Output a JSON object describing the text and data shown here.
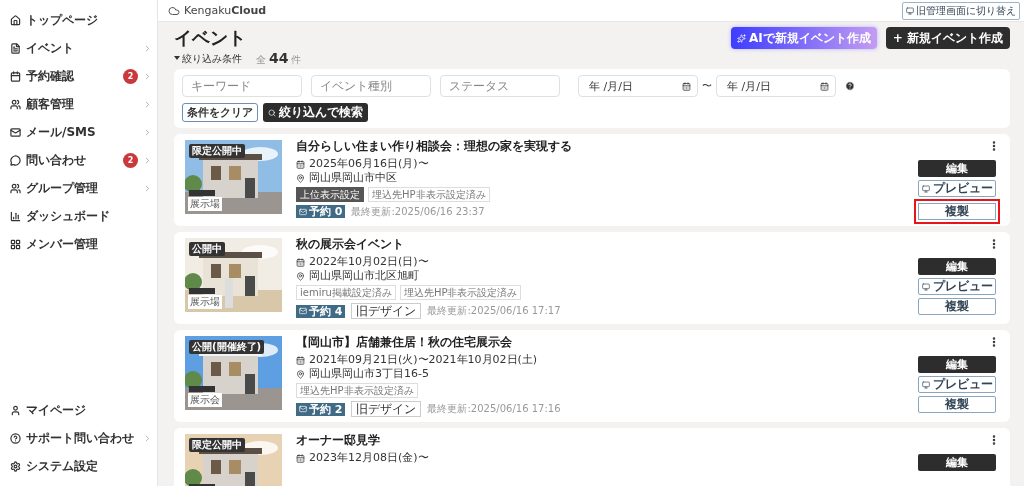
{
  "sidebar": {
    "items": [
      {
        "label": "トップページ",
        "chevron": false
      },
      {
        "label": "イベント",
        "chevron": true
      },
      {
        "label": "予約確認",
        "badge": "2",
        "chevron": true
      },
      {
        "label": "顧客管理",
        "chevron": true
      },
      {
        "label": "メール/SMS",
        "chevron": true
      },
      {
        "label": "問い合わせ",
        "badge": "2",
        "chevron": true
      },
      {
        "label": "グループ管理",
        "chevron": true
      },
      {
        "label": "ダッシュボード",
        "chevron": false
      },
      {
        "label": "メンバー管理",
        "chevron": false
      }
    ],
    "bottom_items": [
      {
        "label": "マイページ",
        "chevron": false
      },
      {
        "label": "サポート問い合わせ",
        "chevron": true
      },
      {
        "label": "システム設定",
        "chevron": false
      }
    ]
  },
  "header": {
    "logo_light": "Kengaku",
    "logo_bold": "Cloud",
    "switch_button": "旧管理画面に切り替え"
  },
  "page": {
    "title": "イベント",
    "ai_button": "AIで新規イベント作成",
    "new_button": "+ 新規イベント作成"
  },
  "filter": {
    "toggle": "絞り込み条件",
    "count_prefix": "全",
    "count": "44",
    "count_suffix": "件",
    "fields": [
      {
        "placeholder": "キーワード"
      },
      {
        "placeholder": "イベント種別"
      },
      {
        "placeholder": "ステータス"
      }
    ],
    "date_from": "年 /月/日",
    "range_sep": "〜",
    "date_to": "年 /月/日",
    "clear_button": "条件をクリア",
    "search_button": "絞り込んで検索"
  },
  "events": [
    {
      "status": "限定公開中",
      "category": "展示場",
      "title": "自分らしい住まい作り相談会：理想の家を実現する",
      "date": "2025年06月16日(月)〜",
      "location": "岡山県岡山市中区",
      "tags": [
        {
          "kind": "dark",
          "label": "上位表示設定"
        },
        {
          "kind": "outline",
          "label": "埋込先HP非表示設定済み"
        }
      ],
      "reservation": "予約 0",
      "updated": "最終更新:2025/06/16 23:37",
      "buttons": {
        "edit": "編集",
        "preview": "プレビュー",
        "copy": "複製"
      },
      "copy_highlighted": true
    },
    {
      "status": "公開中",
      "category": "展示場",
      "title": "秋の展示会イベント",
      "date": "2022年10月02日(日)〜",
      "location": "岡山県岡山市北区旭町",
      "tags": [
        {
          "kind": "outline",
          "label": "iemiru掲載設定済み"
        },
        {
          "kind": "outline",
          "label": "埋込先HP非表示設定済み"
        }
      ],
      "reservation": "予約 4",
      "design": "旧デザイン",
      "updated": "最終更新:2025/06/16 17:17",
      "buttons": {
        "edit": "編集",
        "preview": "プレビュー",
        "copy": "複製"
      },
      "copy_highlighted": false
    },
    {
      "status": "公開(開催終了)",
      "category": "展示会",
      "title": "【岡山市】店舗兼住居！秋の住宅展示会",
      "date": "2021年09月21日(火)〜2021年10月02日(土)",
      "location": "岡山県岡山市3丁目16-5",
      "tags": [
        {
          "kind": "outline",
          "label": "埋込先HP非表示設定済み"
        }
      ],
      "reservation": "予約 2",
      "design": "旧デザイン",
      "updated": "最終更新:2025/06/16 17:16",
      "buttons": {
        "edit": "編集",
        "preview": "プレビュー",
        "copy": "複製"
      },
      "copy_highlighted": false
    },
    {
      "status": "限定公開中",
      "title": "オーナー邸見学",
      "date": "2023年12月08日(金)〜",
      "buttons": {
        "edit": "編集"
      }
    }
  ]
}
